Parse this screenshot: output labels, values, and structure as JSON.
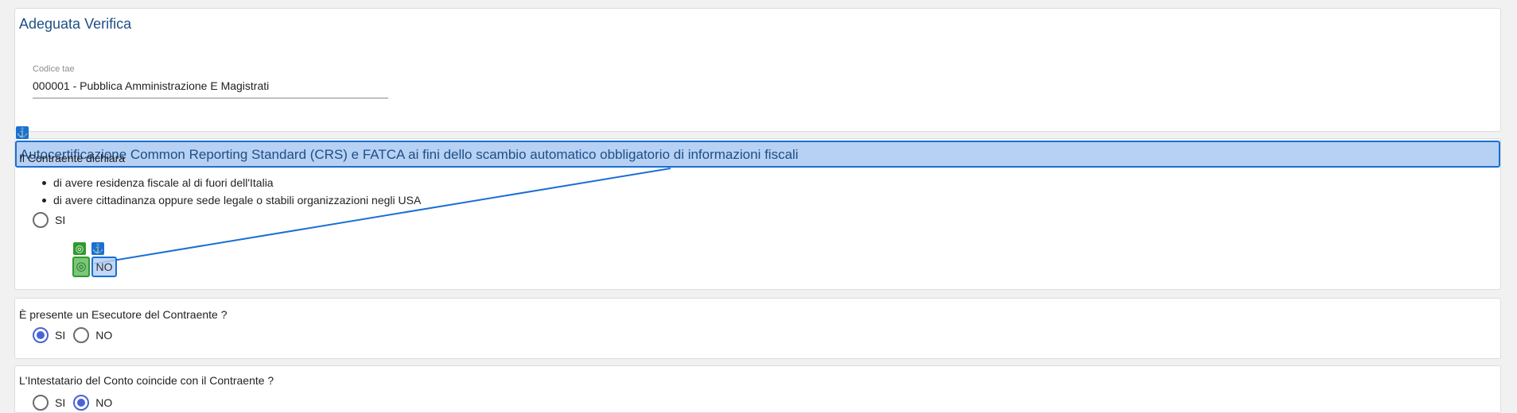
{
  "section1": {
    "title": "Adeguata Verifica",
    "field_label": "Codice tae",
    "field_value": "000001 - Pubblica Amministrazione E Magistrati"
  },
  "section2": {
    "title": "Autocertificazione Common Reporting Standard (CRS) e FATCA ai fini dello scambio automatico obbligatorio di informazioni fiscali",
    "intro": "Il Contraente dichiara",
    "bullets": [
      "di avere residenza fiscale al di fuori dell'Italia",
      "di avere cittadinanza oppure sede legale o stabili organizzazioni negli USA"
    ],
    "option_yes": "SI",
    "option_no": "NO"
  },
  "question2": {
    "text": "È presente un Esecutore del Contraente ?",
    "option_yes": "SI",
    "option_no": "NO",
    "selected": "SI"
  },
  "question3": {
    "text": "L'Intestatario del Conto coincide con il Contraente ?",
    "option_yes": "SI",
    "option_no": "NO",
    "selected": "NO"
  },
  "overlay": {
    "anchor_icon": "⚓",
    "target_icon": "◎",
    "colors": {
      "anchor": "#1a6fd3",
      "target": "#2e9a2e",
      "highlight": "#b7d1f4"
    }
  }
}
